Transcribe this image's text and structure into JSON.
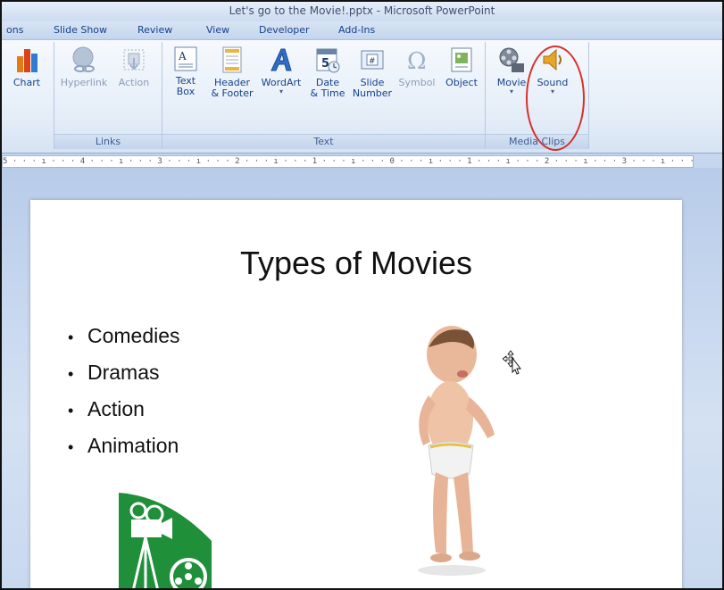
{
  "window": {
    "title": "Let's go to the Movie!.pptx - Microsoft PowerPoint"
  },
  "tabs": [
    {
      "label": "ons"
    },
    {
      "label": "Slide Show"
    },
    {
      "label": "Review"
    },
    {
      "label": "View"
    },
    {
      "label": "Developer"
    },
    {
      "label": "Add-Ins"
    }
  ],
  "ribbon": {
    "chart": {
      "label": "Chart",
      "icon": "chart-icon"
    },
    "links_group": {
      "label": "Links",
      "hyperlink": {
        "label": "Hyperlink",
        "icon": "hyperlink-icon"
      },
      "action": {
        "label": "Action",
        "icon": "action-icon"
      }
    },
    "text_group": {
      "label": "Text",
      "text_box": {
        "line1": "Text",
        "line2": "Box",
        "icon": "text-box-icon"
      },
      "header_footer": {
        "line1": "Header",
        "line2": "& Footer",
        "icon": "header-footer-icon"
      },
      "wordart": {
        "line1": "WordArt",
        "icon": "wordart-icon"
      },
      "date_time": {
        "line1": "Date",
        "line2": "& Time",
        "icon": "date-time-icon"
      },
      "slide_number": {
        "line1": "Slide",
        "line2": "Number",
        "icon": "slide-number-icon"
      },
      "symbol": {
        "line1": "Symbol",
        "icon": "symbol-icon"
      },
      "object": {
        "line1": "Object",
        "icon": "object-icon"
      }
    },
    "media_group": {
      "label": "Media Clips",
      "movie": {
        "line1": "Movie",
        "icon": "movie-icon"
      },
      "sound": {
        "line1": "Sound",
        "icon": "sound-icon"
      }
    },
    "dropdown_arrow": "▾"
  },
  "ruler": {
    "text": "5 · · · ı · · · 4 · · · ı · · · 3 · · · ı · · · 2 · · · ı · · · 1 · · · ı · · · 0 · · · ı · · · 1 · · · ı · · · 2 · · · ı · · · 3 · · · ı · · · 4 · · · ı · · ·"
  },
  "slide": {
    "title": "Types of Movies",
    "bullet_char": "•",
    "bullets": [
      "Comedies",
      "Dramas",
      "Action",
      "Animation"
    ]
  },
  "colors": {
    "annotation_circle": "#d6302a",
    "logo_green": "#1f8f3a",
    "ribbon_text": "#15428b"
  }
}
